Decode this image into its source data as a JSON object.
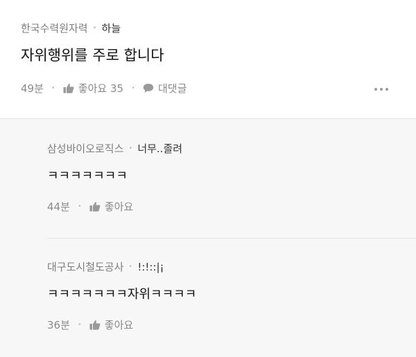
{
  "post": {
    "author": "한국수력원자력",
    "nickname": "하늘",
    "body": "자위행위를 주로 합니다",
    "time": "49분",
    "like_label": "좋아요 35",
    "reply_label": "대댓글",
    "icons": {
      "like": "thumbs-up-icon",
      "reply": "speech-bubble-icon",
      "more": "more-dots-icon"
    }
  },
  "replies": [
    {
      "author": "삼성바이오로직스",
      "nickname": "너무..졸려",
      "body": "ㅋㅋㅋㅋㅋㅋㅋ",
      "time": "44분",
      "like_label": "좋아요"
    },
    {
      "author": "대구도시철도공사",
      "nickname": "!:!::|¡",
      "body": "ㅋㅋㅋㅋㅋㅋㅋ자위ㅋㅋㅋㅋ",
      "time": "36분",
      "like_label": "좋아요"
    }
  ],
  "colors": {
    "reply_background": "#f7f7f7",
    "meta_text": "#7d7d7d",
    "body_text": "#111111"
  }
}
